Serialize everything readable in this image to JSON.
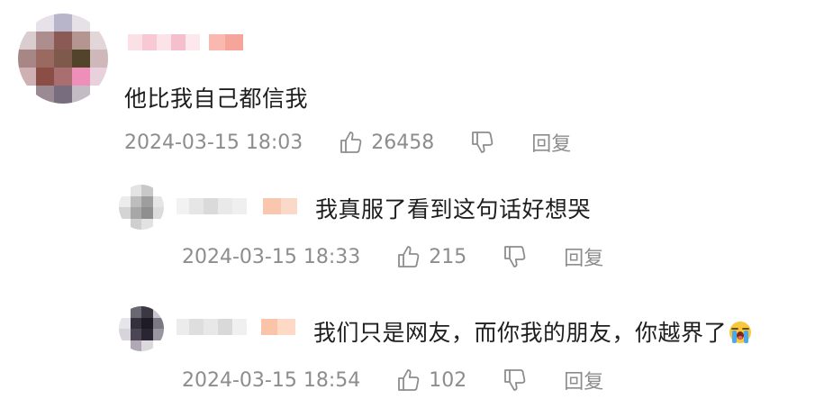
{
  "colors": {
    "text_primary": "#1e1e1e",
    "text_meta": "#8d8d8d",
    "background": "#ffffff"
  },
  "comments": [
    {
      "text": "他比我自己都信我",
      "date": "2024-03-15 18:03",
      "likes": "26458",
      "reply_label": "回复",
      "is_reply": false
    },
    {
      "text": "我真服了看到这句话好想哭",
      "date": "2024-03-15 18:33",
      "likes": "215",
      "reply_label": "回复",
      "is_reply": true
    },
    {
      "text": "我们只是网友，而你我的朋友，你越界了",
      "emoji": "loudly-crying-face-emoji",
      "date": "2024-03-15 18:54",
      "likes": "102",
      "reply_label": "回复",
      "is_reply": true
    }
  ]
}
